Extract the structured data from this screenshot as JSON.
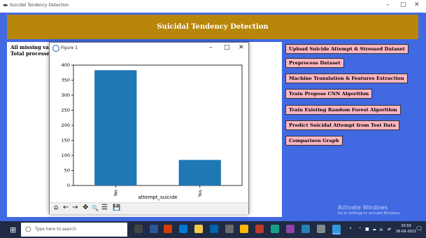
{
  "window": {
    "title": "Suicidal Tendency Detection",
    "minimize": "–",
    "maximize": "□",
    "close": "✕"
  },
  "header": {
    "title": "Suicidal Tendency Detection"
  },
  "output": {
    "line1": "All missing values",
    "line2": "Total processed re"
  },
  "buttons": [
    "Upload Suicide Attempt & Stressed Dataset",
    "Preprocess Dataset",
    "Machine Translation & Features Extraction",
    "Train Propose CNN Algorithm",
    "Train Existing Random Forest Algorithm",
    "Predict Suicidal Attempt from Test Data",
    "Comparison Graph"
  ],
  "figure": {
    "title": "Figure 1",
    "minimize": "–",
    "maximize": "□",
    "close": "✕",
    "tools": [
      "⌂",
      "←",
      "→",
      "✥",
      "🔍",
      "☰",
      "💾"
    ]
  },
  "chart_data": {
    "type": "bar",
    "categories": [
      "No",
      "Yes"
    ],
    "values": [
      383,
      85
    ],
    "xlabel": "attempt_suicide",
    "ylabel": "",
    "ylim": [
      0,
      400
    ],
    "yticks": [
      0,
      50,
      100,
      150,
      200,
      250,
      300,
      350,
      400
    ],
    "bar_color": "#1f77b4",
    "grid": false
  },
  "watermark": {
    "line1": "Activate Windows",
    "line2": "Go to Settings to activate Windows."
  },
  "taskbar": {
    "search_placeholder": "Type here to search",
    "time": "20:59",
    "date": "26-06-2022"
  },
  "colors": {
    "background": "#4169e1",
    "banner": "#b8860b",
    "button": "#ffb6c1",
    "bar": "#1f77b4",
    "taskbar": "#1f2a44"
  }
}
